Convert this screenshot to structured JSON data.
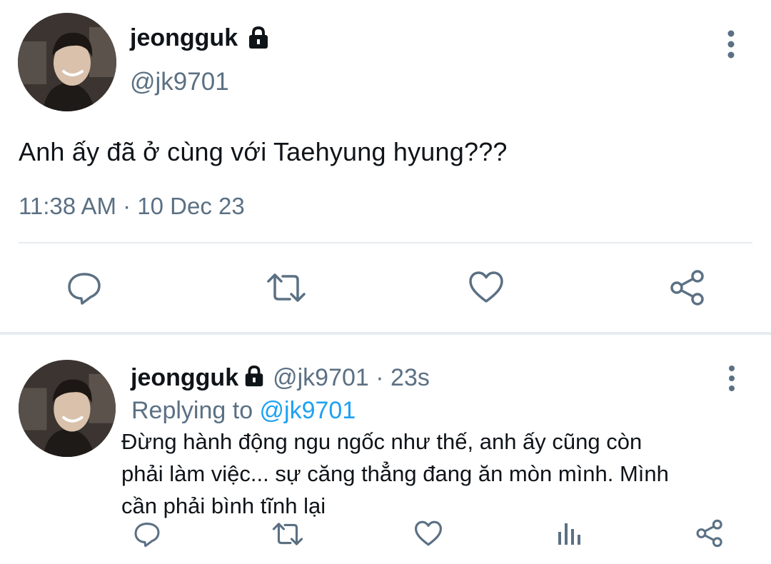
{
  "main_tweet": {
    "display_name": "jeongguk",
    "handle": "@jk9701",
    "text": "Anh ấy đã ở cùng với Taehyung hyung???",
    "meta": "11:38 AM · 10 Dec 23",
    "icons": [
      "avatar-photo",
      "lock-icon",
      "more-icon",
      "reply-icon",
      "retweet-icon",
      "like-icon",
      "share-icon"
    ]
  },
  "reply_tweet": {
    "display_name": "jeongguk",
    "handle_time": "@jk9701 · 23s",
    "replying_prefix": "Replying to ",
    "replying_handle": "@jk9701",
    "text_lines": [
      "Đừng hành động ngu ngốc như thế, anh ấy cũng còn",
      "phải làm việc... sự căng thẳng đang ăn mòn mình. Mình",
      "cần phải bình tĩnh lại"
    ],
    "icons": [
      "avatar-photo",
      "lock-icon",
      "more-icon",
      "reply-icon",
      "retweet-icon",
      "like-icon",
      "stats-icon",
      "share-icon"
    ]
  },
  "colors": {
    "text": "#0f1419",
    "secondary": "#5b7083",
    "link": "#1da1f2",
    "divider": "#e6ecf0",
    "icon": "#5b7083"
  }
}
